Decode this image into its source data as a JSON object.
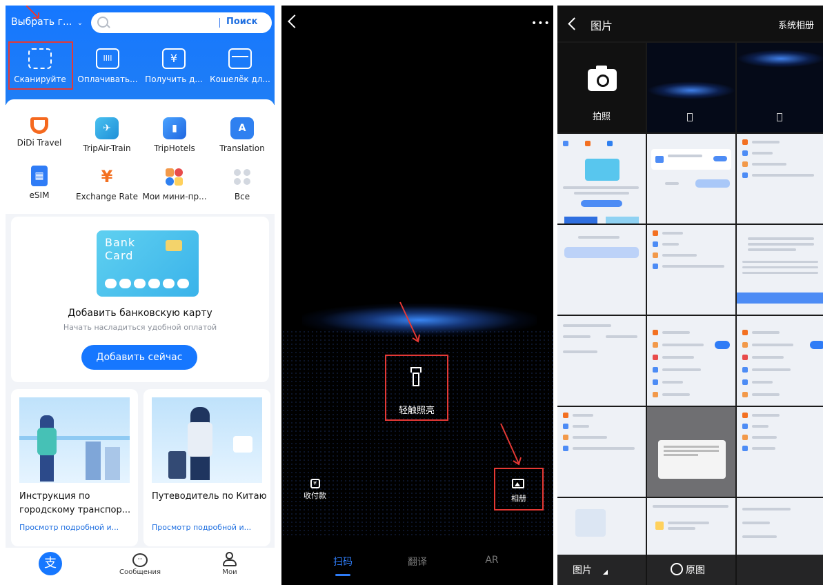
{
  "alipay_home": {
    "city_selector": "Выбрать г...",
    "search_button": "Поиск",
    "quick_actions": [
      "Сканируйте",
      "Оплачивать...",
      "Получить д...",
      "Кошелёк дл..."
    ],
    "quick_glyphs": [
      "",
      "IIII",
      "¥",
      ""
    ],
    "services": [
      {
        "label": "DiDi Travel",
        "glyph": "",
        "color": "#f5691f",
        "icon": "didi-icon"
      },
      {
        "label": "TripAir-Train",
        "glyph": "",
        "color": "#2fa9e6",
        "icon": "plane-train-icon"
      },
      {
        "label": "TripHotels",
        "glyph": "",
        "color": "#2f80f0",
        "icon": "hotel-icon"
      },
      {
        "label": "Translation",
        "glyph": "A",
        "color": "#2f80f0",
        "icon": "translation-icon"
      },
      {
        "label": "eSIM",
        "glyph": "▦",
        "color": "#2f7cf6",
        "icon": "esim-icon"
      },
      {
        "label": "Exchange Rate",
        "glyph": "¥",
        "color": "#f37021",
        "icon": "exchange-rate-icon"
      },
      {
        "label": "Мои мини-пр...",
        "glyph": "",
        "color": "#f2994a",
        "icon": "mini-programs-icon"
      },
      {
        "label": "Все",
        "glyph": "",
        "color": "#d7dbe3",
        "icon": "all-services-icon"
      }
    ],
    "bank_card": {
      "art_text": "Bank Card",
      "title": "Добавить банковскую карту",
      "subtitle": "Начать насладиться удобной оплатой",
      "button": "Добавить сейчас"
    },
    "guides": [
      {
        "title": "Инструкция по городскому транспор...",
        "link": "Просмотр подробной и..."
      },
      {
        "title": "Путеводитель по Китаю",
        "link": "Просмотр подробной и..."
      }
    ],
    "tabs": [
      {
        "label": "",
        "glyph": "支",
        "icon": "alipay-home-icon"
      },
      {
        "label": "Сообщения",
        "glyph": "",
        "icon": "messages-icon"
      },
      {
        "label": "Мои",
        "glyph": "",
        "icon": "profile-icon"
      }
    ]
  },
  "scanner": {
    "more": "•••",
    "flashlight_label": "轻触照亮",
    "pay_label": "收付款",
    "pay_glyph": "¥",
    "album_label": "相册",
    "tabs": [
      "扫码",
      "翻译",
      "AR"
    ]
  },
  "gallery": {
    "title": "图片",
    "system_album": "系统相册",
    "camera_label": "拍照",
    "footer_album": "图片",
    "original_label": "原图"
  },
  "colors": {
    "alipay_blue": "#1677ff",
    "highlight_red": "#e53935",
    "scanner_bg": "#000000",
    "gallery_bg": "#1a1a1a"
  }
}
